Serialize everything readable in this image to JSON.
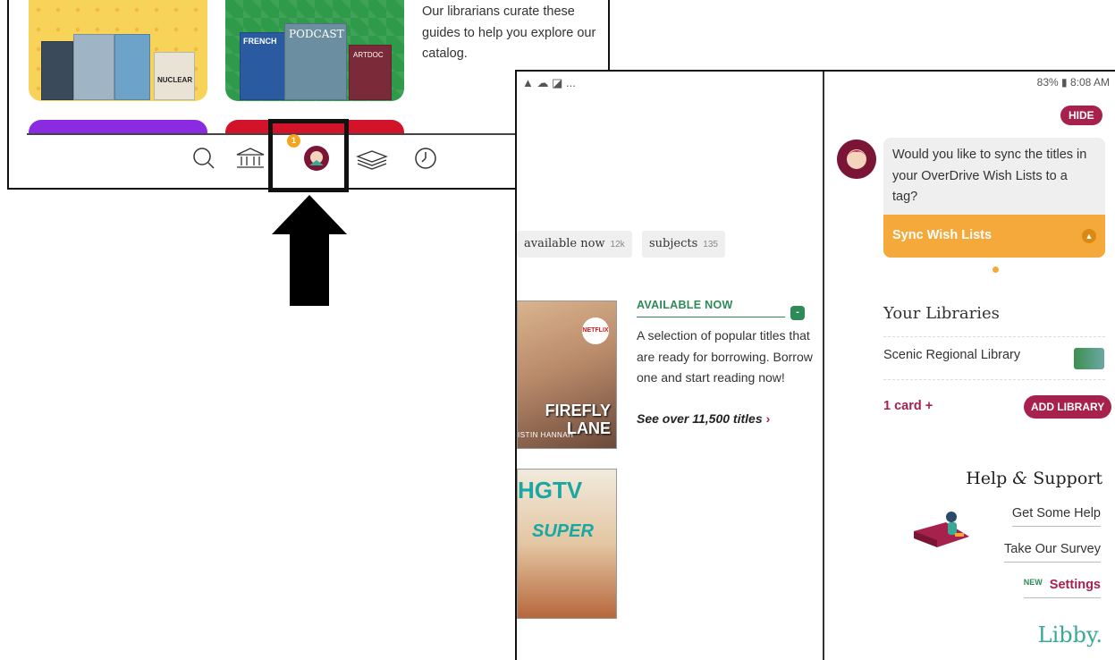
{
  "shot1": {
    "blurb": "Our librarians curate these guides to help you explore our catalog.",
    "notification_count": "1",
    "nav": [
      "search-icon",
      "library-icon",
      "libby-shelf-icon",
      "books-icon",
      "clock-icon"
    ],
    "tiles": {
      "yellow_color": "#f8d35a",
      "green_color": "#2f9a4a",
      "purple_color": "#8a2be2",
      "red_color": "#d3132a"
    },
    "covers": {
      "podcast": "PODCAST",
      "french": "FRENCH",
      "nuclear": "NUCLEAR",
      "artdoc": "ARTDOC"
    }
  },
  "shot2": {
    "status_left": "▲ ☁ ◪ ...",
    "status_right": "83% ▮ 8:08 AM",
    "chips": [
      {
        "label": "available now",
        "count": "12k"
      },
      {
        "label": "subjects",
        "count": "135"
      }
    ],
    "available": {
      "heading": "AVAILABLE NOW",
      "badge": "-",
      "description": "A selection of popular titles that are ready for borrowing. Borrow one and start reading now!",
      "link": "See over 11,500 titles",
      "chevron": "›"
    },
    "cover1": {
      "title_line1": "FIREFLY",
      "title_line2": "LANE",
      "author": "ISTIN HANNAH",
      "badge": "NETFLIX"
    },
    "cover2": {
      "title": "HGTV",
      "subtitle": "SUPER"
    },
    "hide_label": "HIDE",
    "bubble_text": "Would you like to sync the titles in your OverDrive Wish Lists to a tag?",
    "sync_label": "Sync Wish Lists",
    "libraries": {
      "heading": "Your Libraries",
      "library_name": "Scenic Regional Library",
      "card_link": "1 card +",
      "add_button": "ADD LIBRARY"
    },
    "help": {
      "heading_part1": "Help ",
      "heading_amp": "&",
      "heading_part2": " Support",
      "links": [
        "Get Some Help",
        "Take Our Survey"
      ],
      "new_tag": "NEW",
      "settings": "Settings"
    },
    "logo": "Libby.",
    "accent_color": "#a6224c",
    "sync_color": "#f4a93a"
  }
}
